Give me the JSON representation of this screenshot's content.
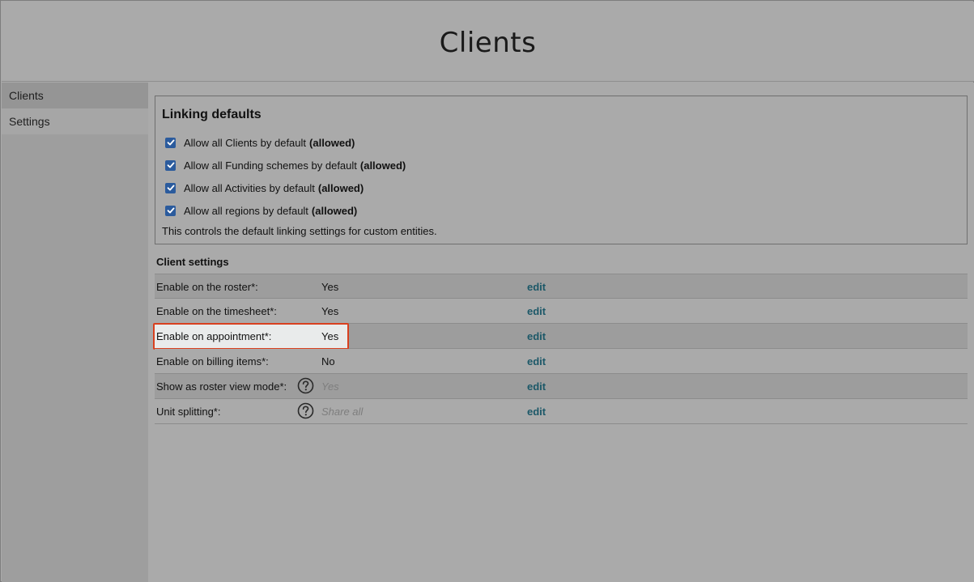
{
  "header": {
    "title": "Clients"
  },
  "sidebar": {
    "items": [
      {
        "label": "Clients"
      },
      {
        "label": "Settings"
      }
    ]
  },
  "linking": {
    "title": "Linking defaults",
    "options": [
      {
        "label": "Allow all Clients by default",
        "status": "(allowed)",
        "checked": true
      },
      {
        "label": "Allow all Funding schemes by default",
        "status": "(allowed)",
        "checked": true
      },
      {
        "label": "Allow all Activities by default",
        "status": "(allowed)",
        "checked": true
      },
      {
        "label": "Allow all regions by default",
        "status": "(allowed)",
        "checked": true
      }
    ],
    "note": "This controls the default linking settings for custom entities."
  },
  "client_settings": {
    "title": "Client settings",
    "edit_label": "edit",
    "rows": [
      {
        "label": "Enable on the roster*:",
        "value": "Yes"
      },
      {
        "label": "Enable on the timesheet*:",
        "value": "Yes"
      },
      {
        "label": "Enable on appointment*:",
        "value": "Yes"
      },
      {
        "label": "Enable on billing items*:",
        "value": "No"
      },
      {
        "label": "Show as roster view mode*:",
        "value": "Yes"
      },
      {
        "label": "Unit splitting*:",
        "value": "Share all"
      }
    ]
  },
  "colors": {
    "accent_link": "#1c5868",
    "highlight_border": "#d9401f",
    "checkbox": "#2b5b9d"
  }
}
